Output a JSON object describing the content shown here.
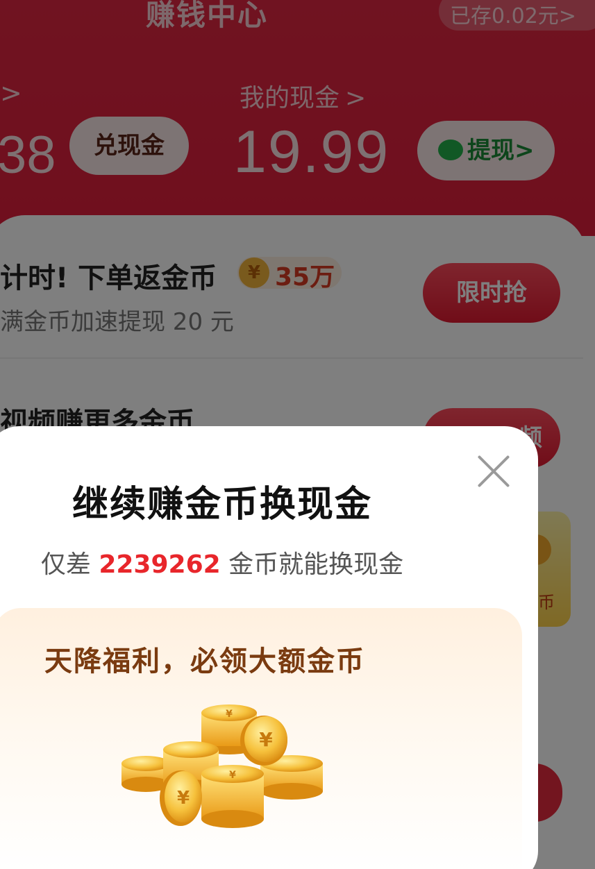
{
  "header": {
    "title": "赚钱中心",
    "saved_text": "已存0.02元>",
    "left_chevron": ">",
    "my_cash_label": "我的现金",
    "my_cash_chevron": ">",
    "coins_value": "38",
    "exchange_button": "兑现金",
    "cash_value": "19.99",
    "withdraw_button": "提现",
    "withdraw_chevron": ">"
  },
  "tasks": [
    {
      "title": "计时! 下单返金币",
      "coin_badge_symbol": "¥",
      "coin_badge": "35万",
      "subtitle": "满金币加速提现 20 元",
      "button": "限时抢"
    },
    {
      "title": "视频赚更多金币",
      "button": "频"
    }
  ],
  "side_card": {
    "text": "币"
  },
  "modal": {
    "title": "继续赚金币换现金",
    "subtitle_prefix": "仅差",
    "subtitle_number": "2239262",
    "subtitle_suffix": "金币就能换现金",
    "bonus_title": "天降福利，必领大额金币"
  },
  "colors": {
    "header_red": "#e02742",
    "accent_red": "#e8262b",
    "wechat_green": "#1a8a36",
    "bonus_brown": "#7a3b10",
    "coin_gold": "#f3b43b"
  }
}
